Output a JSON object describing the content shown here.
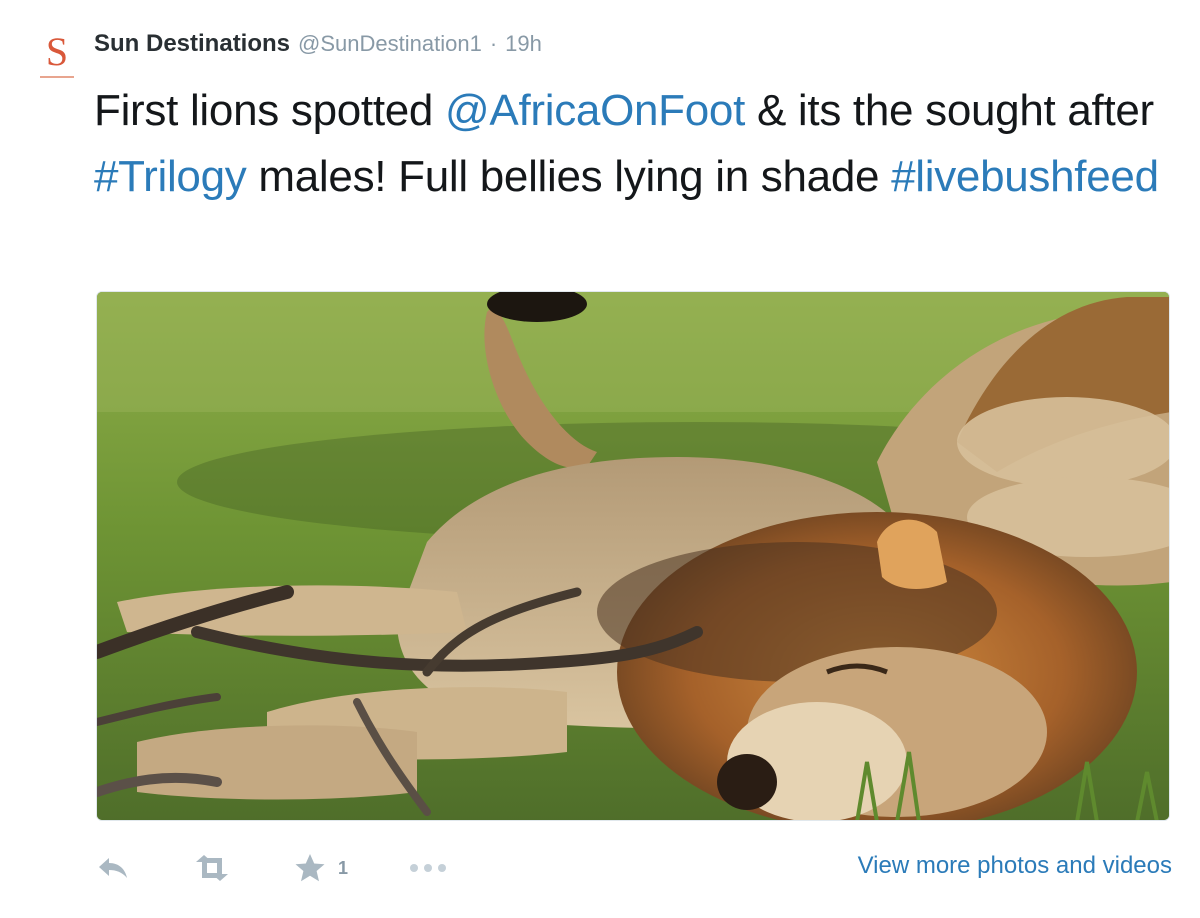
{
  "account": {
    "avatar_letter": "S",
    "display_name": "Sun Destinations",
    "handle": "@SunDestination1",
    "separator": "·",
    "timestamp": "19h"
  },
  "tweet": {
    "segments": [
      {
        "text": "First lions spotted ",
        "type": "text"
      },
      {
        "text": "@AfricaOnFoot",
        "type": "mention"
      },
      {
        "text": " & its the sought after ",
        "type": "text"
      },
      {
        "text": "#Trilogy",
        "type": "hashtag"
      },
      {
        "text": " males! Full bellies lying in shade ",
        "type": "text"
      },
      {
        "text": "#livebushfeed",
        "type": "hashtag"
      }
    ]
  },
  "media": {
    "icon": "lion-photo",
    "palette": {
      "grass": "#7c9a3c",
      "mane": "#b36d2b",
      "fur": "#c9ad86"
    }
  },
  "actions": {
    "reply_icon": "reply-icon",
    "retweet_icon": "retweet-icon",
    "favorite_icon": "star-icon",
    "favorite_count": "1",
    "more_icon": "more-icon"
  },
  "view_more_label": "View more photos and videos",
  "colors": {
    "link": "#2b7bb9",
    "muted": "#8899a6",
    "text": "#14171a",
    "avatar": "#d9583a"
  }
}
